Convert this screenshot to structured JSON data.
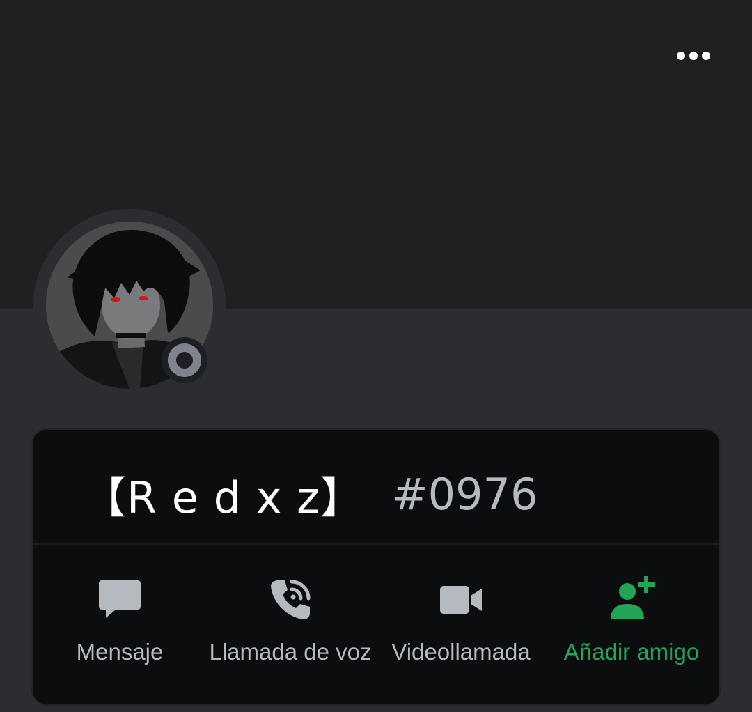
{
  "profile": {
    "username": "【R e d x z】",
    "discriminator": "#0976",
    "status": "offline"
  },
  "header": {
    "more_icon": "more-options-icon"
  },
  "actions": [
    {
      "label": "Mensaje",
      "icon": "message-icon"
    },
    {
      "label": "Llamada de voz",
      "icon": "voice-call-icon"
    },
    {
      "label": "Videollamada",
      "icon": "video-call-icon"
    },
    {
      "label": "Añadir amigo",
      "icon": "add-friend-icon"
    }
  ],
  "colors": {
    "banner": "#202022",
    "background": "#2b2d31",
    "card": "#0c0d0f",
    "icon_gray": "#b5bac1",
    "accent_green": "#23a559",
    "status_offline": "#80848e"
  }
}
